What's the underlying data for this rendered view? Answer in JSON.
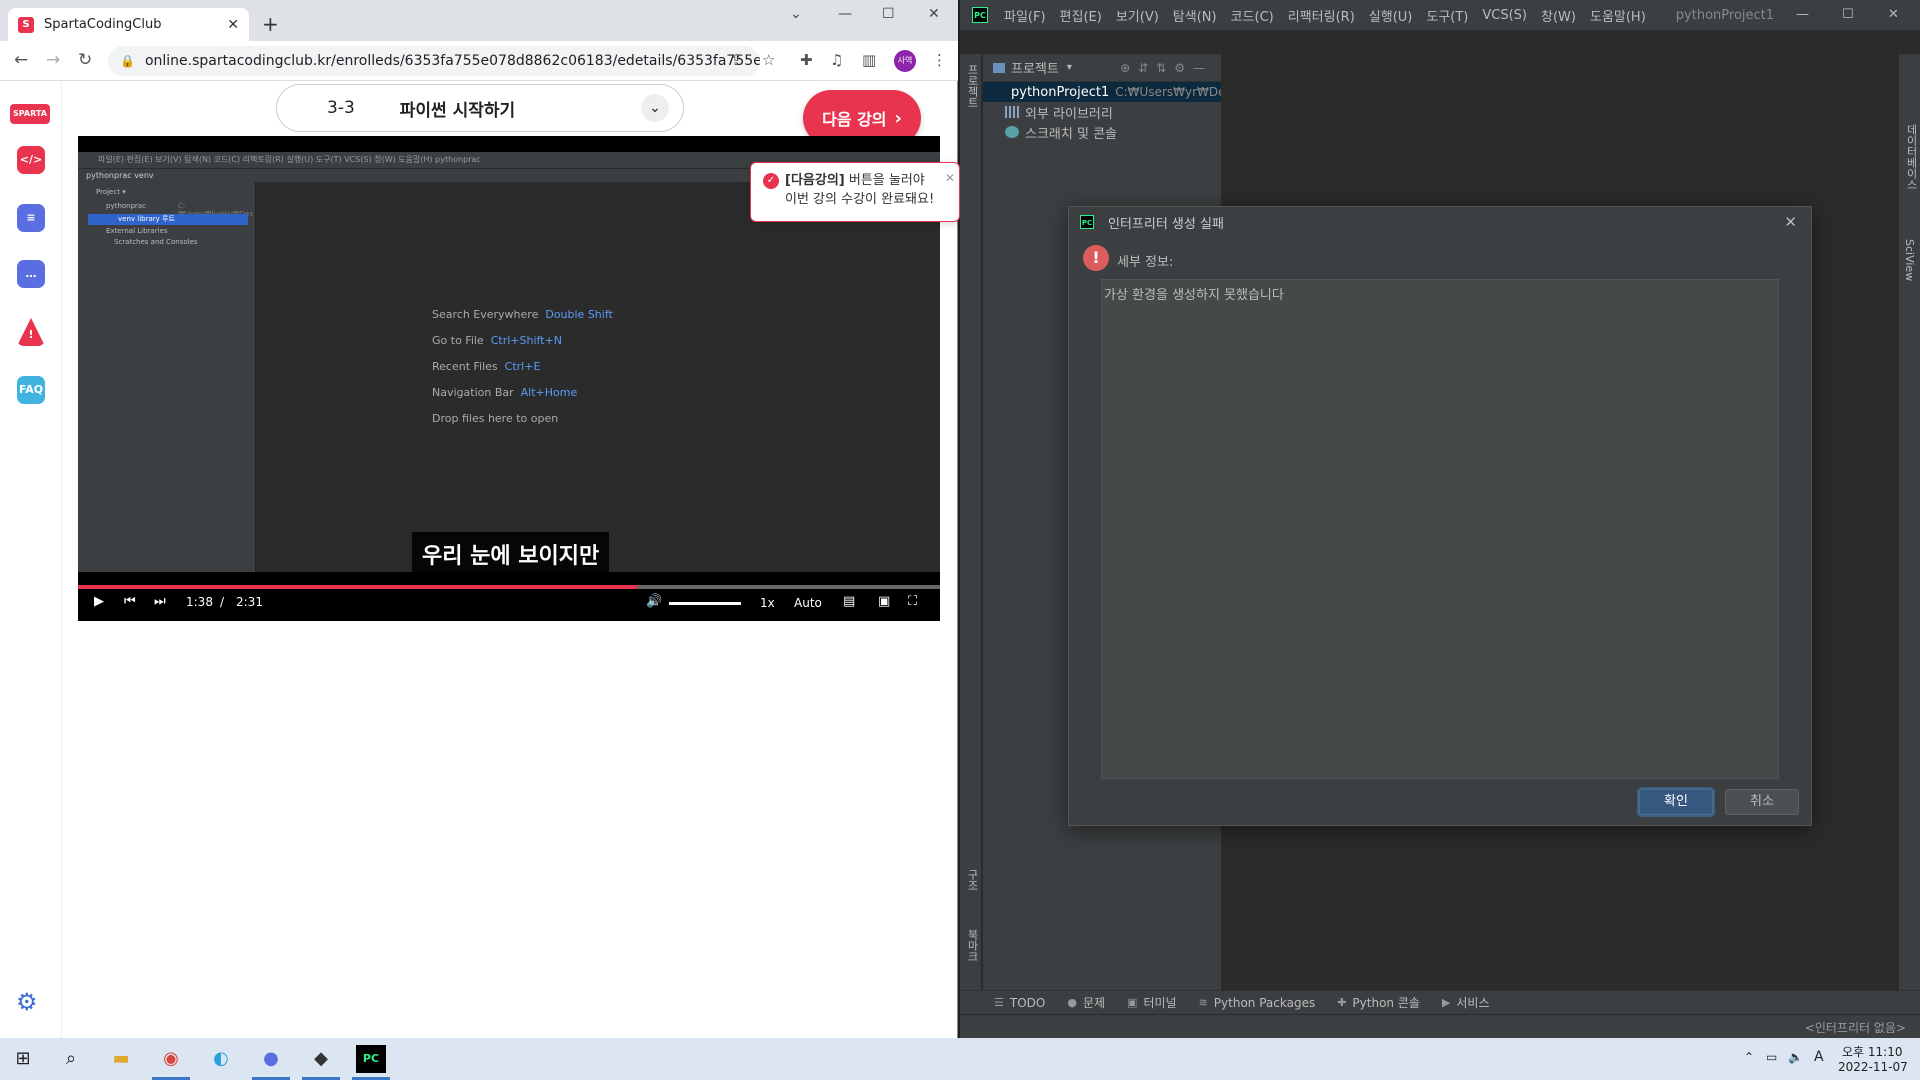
{
  "browser": {
    "tab_title": "SpartaCodingClub",
    "url": "online.spartacodingclub.kr/enrolleds/6353fa755e078d8862c06183/edetails/6353fa755e07...",
    "profile_label": "사역"
  },
  "sidebar": {
    "logo": "SPARTA",
    "items": [
      {
        "label": "</>",
        "color": "#e8344e"
      },
      {
        "label": "≡",
        "color": "#5b6ee1"
      },
      {
        "label": "…",
        "color": "#5b6ee1"
      },
      {
        "label": "!",
        "color": "#e8344e"
      },
      {
        "label": "FAQ",
        "color": "#40b3e0"
      }
    ]
  },
  "lecture": {
    "number": "3-3",
    "title": "파이썬 시작하기",
    "next_button": "다음 강의"
  },
  "toast": {
    "highlight": "[다음강의]",
    "line1": " 버튼을 눌러야",
    "line2": "이번 강의 수강이 완료돼요!"
  },
  "video": {
    "subtitle": "우리 눈에 보이지만",
    "current_time": "1:38",
    "separator": "/",
    "total_time": "2:31",
    "progress": 0.649,
    "speed": "1x",
    "quality": "Auto",
    "screen": {
      "menu": "파일(E)  편집(E)  보기(V)  탐색(N)  코드(C)  리팩토링(R)  실행(U)  도구(T)  VCS(S)  창(W)  도움말(H)     pythonprac",
      "path": "pythonprac  venv",
      "tree": [
        "Project ▾",
        "pythonprac",
        "venv  library 루트",
        "External Libraries",
        "Scratches and Consoles"
      ],
      "tree_path": "C:₩Users₩hunky₩Des",
      "hints": [
        {
          "label": "Search Everywhere",
          "key": "Double Shift"
        },
        {
          "label": "Go to File",
          "key": "Ctrl+Shift+N"
        },
        {
          "label": "Recent Files",
          "key": "Ctrl+E"
        },
        {
          "label": "Navigation Bar",
          "key": "Alt+Home"
        },
        {
          "label": "Drop files here to open",
          "key": ""
        }
      ]
    }
  },
  "ide": {
    "menu": [
      "파일(F)",
      "편집(E)",
      "보기(V)",
      "탐색(N)",
      "코드(C)",
      "리팩터링(R)",
      "실행(U)",
      "도구(T)",
      "VCS(S)",
      "창(W)",
      "도움말(H)"
    ],
    "project_title": "pythonProject1",
    "left_strip_project": "프로젝트",
    "left_strip_structure": "구조",
    "left_strip_bookmarks": "북마크",
    "right_strip_db": "데이터베이스",
    "right_strip_sciview": "SciView",
    "project_panel": {
      "header": "프로젝트",
      "tree": [
        {
          "label": "pythonProject1",
          "path": "C:₩Users₩yr₩Deskt"
        },
        {
          "label": "외부 라이브러리",
          "path": ""
        },
        {
          "label": "스크래치 및 콘솔",
          "path": ""
        }
      ]
    },
    "bottom_tabs": [
      {
        "icon": "☰",
        "label": "TODO"
      },
      {
        "icon": "●",
        "label": "문제"
      },
      {
        "icon": "▣",
        "label": "터미널"
      },
      {
        "icon": "≋",
        "label": "Python Packages"
      },
      {
        "icon": "✚",
        "label": "Python 콘솔"
      },
      {
        "icon": "▶",
        "label": "서비스"
      }
    ],
    "status_interpreter": "<인터프리터 없음>"
  },
  "dialog": {
    "title": "인터프리터 생성 실패",
    "label": "세부 정보:",
    "message": "가상 환경을 생성하지 못했습니다",
    "ok": "확인",
    "cancel": "취소"
  },
  "taskbar": {
    "time": "오후 11:10",
    "date": "2022-11-07",
    "ime": "A"
  }
}
